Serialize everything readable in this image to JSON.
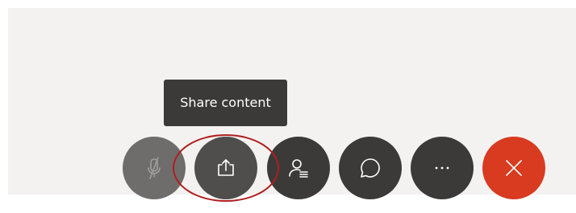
{
  "tooltip": {
    "text": "Share content"
  },
  "controls": [
    {
      "name": "mute-button",
      "icon": "microphone-off-icon",
      "state": "muted"
    },
    {
      "name": "share-content-button",
      "icon": "share-upload-icon",
      "state": "hovered"
    },
    {
      "name": "participants-button",
      "icon": "participants-list-icon"
    },
    {
      "name": "chat-button",
      "icon": "chat-bubble-icon"
    },
    {
      "name": "more-options-button",
      "icon": "ellipsis-icon"
    },
    {
      "name": "end-call-button",
      "icon": "close-icon"
    }
  ],
  "colors": {
    "background": "#f3f2f1",
    "button": "#3b3a39",
    "muted_button": "#6e6d6c",
    "end_call": "#d83b20",
    "annotation_circle": "#b01e1e"
  }
}
